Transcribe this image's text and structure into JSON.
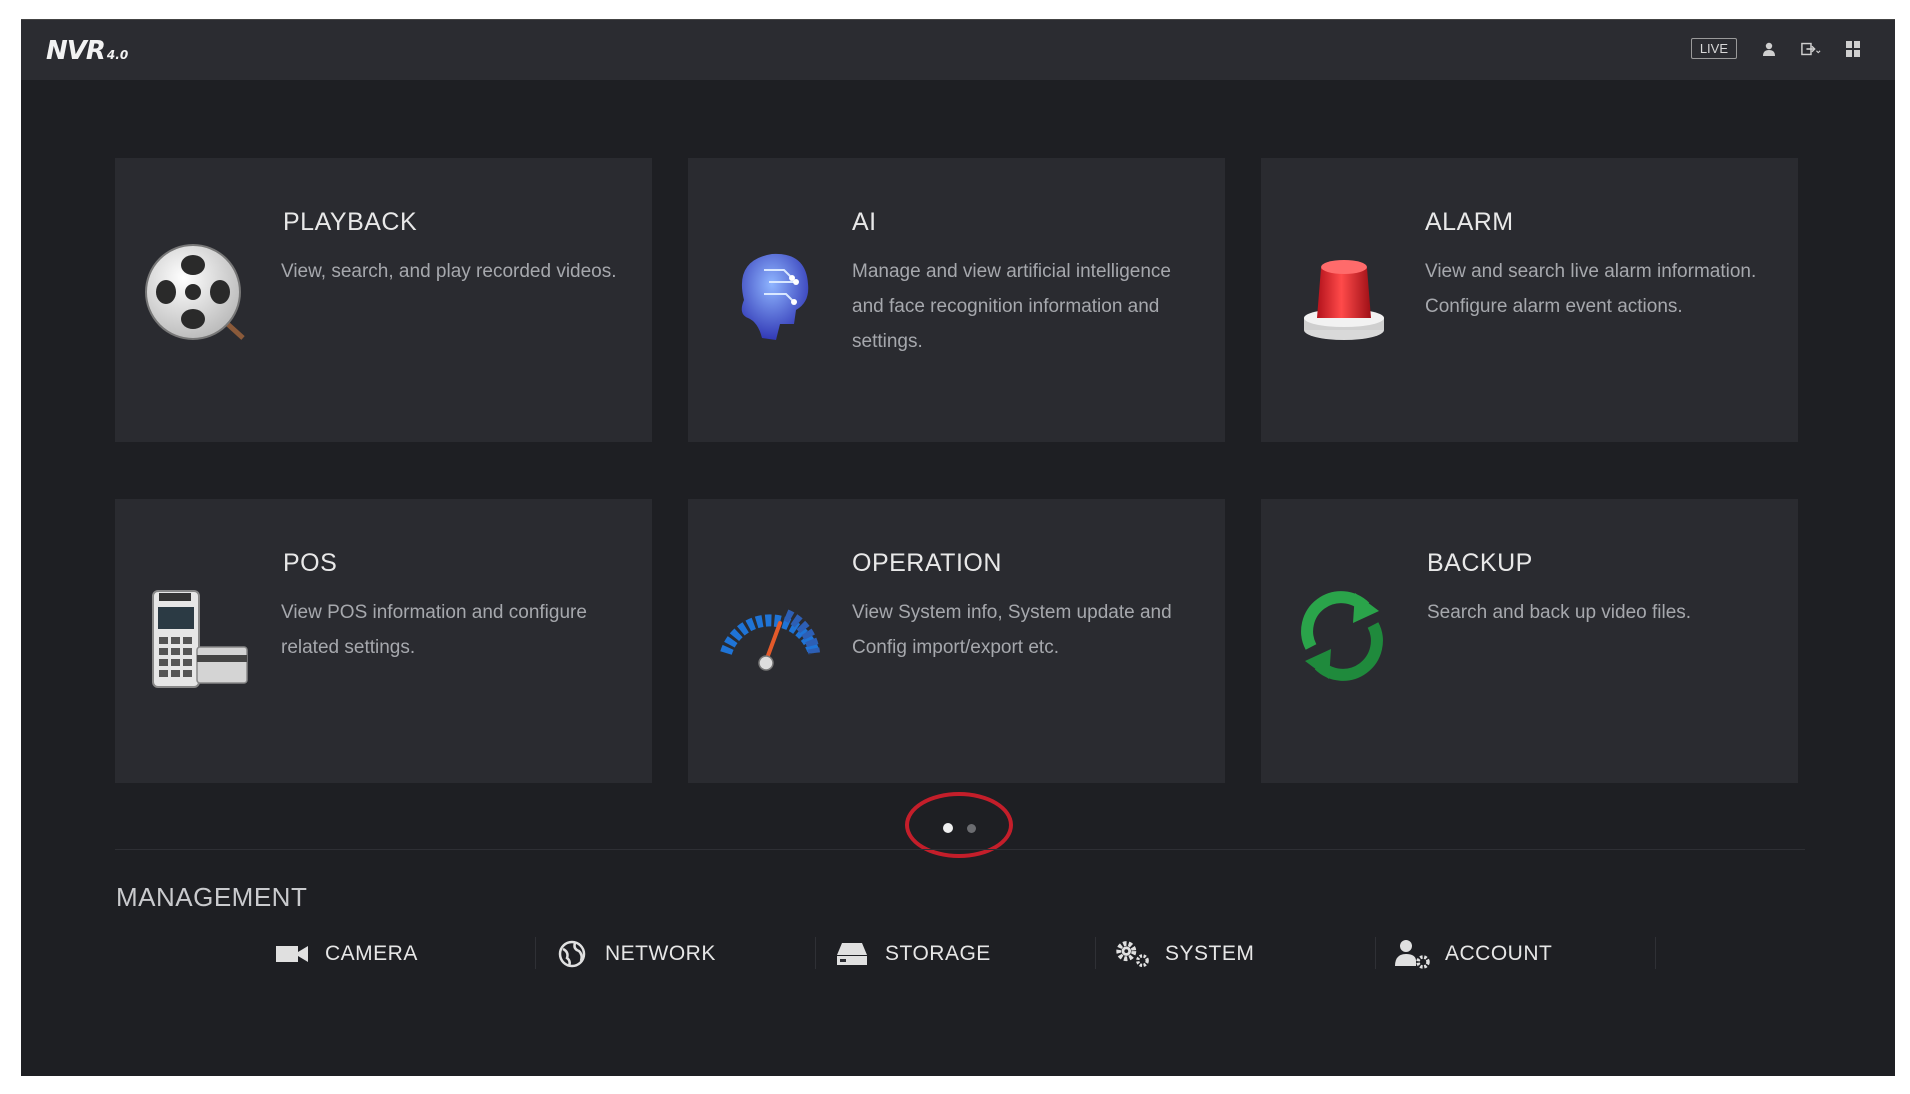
{
  "topbar": {
    "logo": "NVR",
    "logo_version": "4.0",
    "live_label": "LIVE",
    "icons": [
      "user-icon",
      "logout-icon",
      "grid-icon"
    ]
  },
  "tiles": [
    {
      "title": "PLAYBACK",
      "description": "View, search, and play recorded videos.",
      "icon": "film-reel-icon"
    },
    {
      "title": "AI",
      "description": "Manage and view artificial intelligence and face recognition information and settings.",
      "icon": "ai-head-icon"
    },
    {
      "title": "ALARM",
      "description": "View and search live alarm information. Configure alarm event actions.",
      "icon": "alarm-siren-icon"
    },
    {
      "title": "POS",
      "description": "View POS information and configure related settings.",
      "icon": "pos-terminal-icon"
    },
    {
      "title": "OPERATION",
      "description": "View System info, System update and Config import/export etc.",
      "icon": "gauge-icon"
    },
    {
      "title": "BACKUP",
      "description": "Search and back up video files.",
      "icon": "sync-arrows-icon"
    }
  ],
  "pager": {
    "pages": 2,
    "current": 1
  },
  "management": {
    "title": "MANAGEMENT",
    "items": [
      {
        "label": "CAMERA",
        "icon": "camera-icon"
      },
      {
        "label": "NETWORK",
        "icon": "globe-icon"
      },
      {
        "label": "STORAGE",
        "icon": "hard-drive-icon"
      },
      {
        "label": "SYSTEM",
        "icon": "gears-icon"
      },
      {
        "label": "ACCOUNT",
        "icon": "user-settings-icon"
      }
    ]
  },
  "colors": {
    "background": "#1e1f23",
    "tile": "#2a2b30",
    "topbar": "#2b2c31",
    "annotation": "#c41e2a"
  }
}
